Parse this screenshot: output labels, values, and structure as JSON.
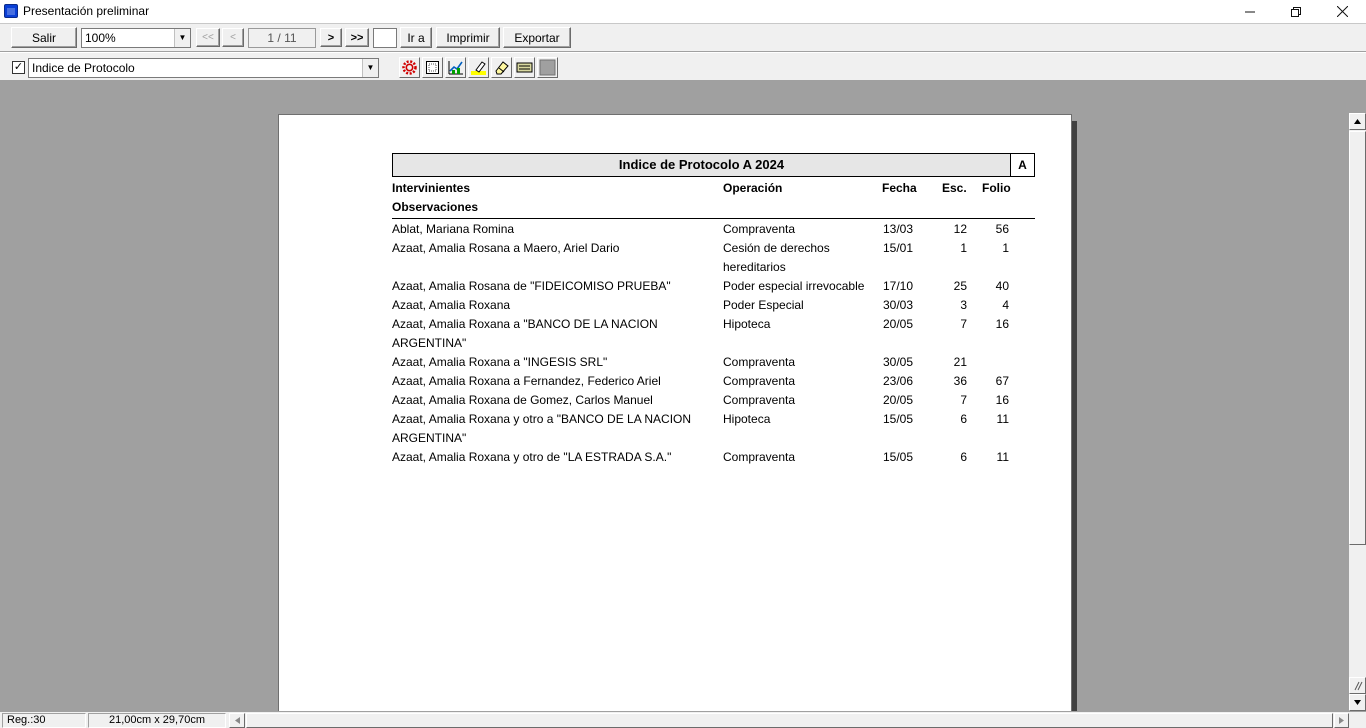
{
  "window": {
    "title": "Presentación preliminar"
  },
  "toolbar": {
    "exit_label": "Salir",
    "zoom_value": "100%",
    "first_label": "<<",
    "prev_label": "<",
    "page_indicator": "1 / 11",
    "next_label": ">",
    "last_label": ">>",
    "goto_label": "Ir a",
    "print_label": "Imprimir",
    "export_label": "Exportar"
  },
  "toolbar2": {
    "checkbox_checked": true,
    "checkbox_mark": "✓",
    "report_select_value": "Indice de Protocolo"
  },
  "report": {
    "title": "Indice de Protocolo A 2024",
    "letter": "A",
    "headers": {
      "intervinientes": "Intervinientes",
      "observaciones": "Observaciones",
      "operacion": "Operación",
      "fecha": "Fecha",
      "esc": "Esc.",
      "folio": "Folio"
    },
    "rows": [
      {
        "intervinientes": "Ablat, Mariana Romina",
        "intervinientes2": "",
        "operacion": "Compraventa",
        "operacion2": "",
        "fecha": "13/03",
        "esc": "12",
        "folio": "56"
      },
      {
        "intervinientes": "Azaat, Amalia Rosana a Maero, Ariel Dario",
        "intervinientes2": "",
        "operacion": "Cesión de derechos",
        "operacion2": "hereditarios",
        "fecha": "15/01",
        "esc": "1",
        "folio": "1"
      },
      {
        "intervinientes": "Azaat, Amalia Rosana de \"FIDEICOMISO PRUEBA\"",
        "intervinientes2": "",
        "operacion": "Poder especial irrevocable",
        "operacion2": "",
        "fecha": "17/10",
        "esc": "25",
        "folio": "40"
      },
      {
        "intervinientes": "Azaat, Amalia Roxana",
        "intervinientes2": "",
        "operacion": "Poder Especial",
        "operacion2": "",
        "fecha": "30/03",
        "esc": "3",
        "folio": "4"
      },
      {
        "intervinientes": "Azaat, Amalia Roxana a \"BANCO DE LA NACION",
        "intervinientes2": "ARGENTINA\"",
        "operacion": "Hipoteca",
        "operacion2": "",
        "fecha": "20/05",
        "esc": "7",
        "folio": "16"
      },
      {
        "intervinientes": "Azaat, Amalia Roxana a \"INGESIS SRL\"",
        "intervinientes2": "",
        "operacion": "Compraventa",
        "operacion2": "",
        "fecha": "30/05",
        "esc": "21",
        "folio": ""
      },
      {
        "intervinientes": "Azaat, Amalia Roxana a Fernandez, Federico Ariel",
        "intervinientes2": "",
        "operacion": "Compraventa",
        "operacion2": "",
        "fecha": "23/06",
        "esc": "36",
        "folio": "67"
      },
      {
        "intervinientes": "Azaat, Amalia Roxana de Gomez, Carlos Manuel",
        "intervinientes2": "",
        "operacion": "Compraventa",
        "operacion2": "",
        "fecha": "20/05",
        "esc": "7",
        "folio": "16"
      },
      {
        "intervinientes": "Azaat, Amalia Roxana y otro a \"BANCO DE LA NACION",
        "intervinientes2": "ARGENTINA\"",
        "operacion": "Hipoteca",
        "operacion2": "",
        "fecha": "15/05",
        "esc": "6",
        "folio": "11"
      },
      {
        "intervinientes": "Azaat, Amalia Roxana y otro de \"LA ESTRADA S.A.\"",
        "intervinientes2": "",
        "operacion": "Compraventa",
        "operacion2": "",
        "fecha": "15/05",
        "esc": "6",
        "folio": "11"
      }
    ]
  },
  "status": {
    "records": "Reg.:30",
    "page_size": "21,00cm x 29,70cm"
  },
  "icons": {
    "settings": "gear-icon",
    "page_setup": "page-setup-icon",
    "chart": "chart-icon",
    "highlighter": "highlighter-icon",
    "eraser": "eraser-icon",
    "fields": "fields-icon",
    "color": "color-icon"
  }
}
